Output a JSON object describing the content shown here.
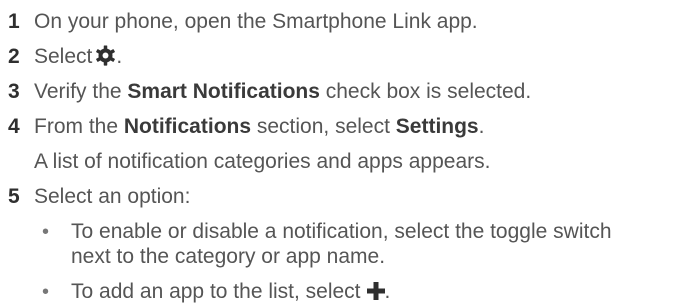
{
  "steps": [
    {
      "num": "1",
      "text": "On your phone, open the Smartphone Link app."
    },
    {
      "num": "2",
      "pre": "Select",
      "icon": "gear-icon",
      "post": "."
    },
    {
      "num": "3",
      "pre": "Verify the ",
      "bold": "Smart Notifications",
      "post": " check box is selected."
    },
    {
      "num": "4",
      "pre": "From the ",
      "bold": "Notifications",
      "mid": " section, select ",
      "bold2": "Settings",
      "post": "."
    },
    {
      "num": "5",
      "text": "Select an option:"
    }
  ],
  "step4_note": "A list of notification categories and apps appears.",
  "bullets": [
    {
      "dot": "•",
      "line1": "To enable or disable a notification, select the toggle switch",
      "line2": "next to the category or app name."
    },
    {
      "dot": "•",
      "pre": "To add an app to the list, select",
      "icon": "plus-icon",
      "post": "."
    }
  ],
  "colors": {
    "body_text": "#555555",
    "numbers": "#2f2f2f",
    "icon": "#2f2f2f"
  }
}
